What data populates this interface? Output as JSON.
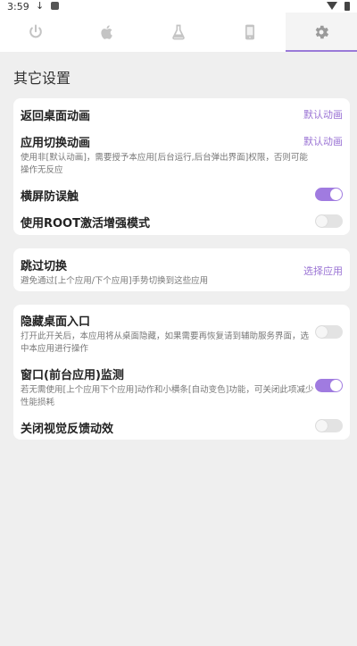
{
  "status_bar": {
    "time": "3:59"
  },
  "tabs": [
    {
      "icon": "power-icon"
    },
    {
      "icon": "apple-icon"
    },
    {
      "icon": "flask-icon"
    },
    {
      "icon": "phone-icon"
    },
    {
      "icon": "gear-icon",
      "active": true
    }
  ],
  "page": {
    "title": "其它设置"
  },
  "sections": {
    "anim": {
      "return_title": "返回桌面动画",
      "return_action": "默认动画",
      "switch_title": "应用切换动画",
      "switch_action": "默认动画",
      "switch_desc": "使用非[默认动画]，需要授予本应用[后台运行,后台弹出界面]权限，否则可能操作无反应",
      "landscape_title": "横屏防误触",
      "landscape_on": true,
      "root_title": "使用ROOT激活增强模式",
      "root_on": false
    },
    "skip": {
      "title": "跳过切换",
      "desc": "避免通过[上个应用/下个应用]手势切换到这些应用",
      "action": "选择应用"
    },
    "misc": {
      "hide_title": "隐藏桌面入口",
      "hide_desc": "打开此开关后，本应用将从桌面隐藏，如果需要再恢复请到辅助服务界面，选中本应用进行操作",
      "hide_on": false,
      "window_title": "窗口(前台应用)监测",
      "window_desc": "若无需使用[上个应用下个应用]动作和小横条[自动变色]功能，可关闭此项减少性能损耗",
      "window_on": true,
      "feedback_title": "关闭视觉反馈动效",
      "feedback_on": false
    }
  },
  "colors": {
    "accent": "#a07be0",
    "accent_text": "#9a73d4",
    "background": "#efefef"
  }
}
